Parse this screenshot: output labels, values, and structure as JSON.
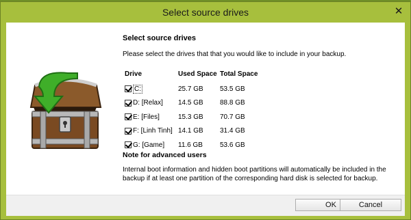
{
  "window": {
    "title": "Select source drives",
    "close_glyph": "✕"
  },
  "main": {
    "heading": "Select source drives",
    "description": "Please select the drives that that you would like to include in your backup.",
    "table": {
      "headers": {
        "drive": "Drive",
        "used": "Used Space",
        "total": "Total Space"
      },
      "rows": [
        {
          "drive": "C:",
          "used": "25.7 GB",
          "total": "53.5 GB",
          "checked": true
        },
        {
          "drive": "D: [Relax]",
          "used": "14.5 GB",
          "total": "88.8 GB",
          "checked": true
        },
        {
          "drive": "E: [Files]",
          "used": "15.3 GB",
          "total": "70.7 GB",
          "checked": true
        },
        {
          "drive": "F: [Linh Tinh]",
          "used": "14.1 GB",
          "total": "31.4 GB",
          "checked": true
        },
        {
          "drive": "G: [Game]",
          "used": "11.6 GB",
          "total": "53.6 GB",
          "checked": true
        }
      ]
    },
    "note_heading": "Note for advanced users",
    "note_text": "Internal boot information and hidden boot partitions will automatically be included in the backup if at least one partition of the corresponding hard disk is selected for backup."
  },
  "footer": {
    "ok_label": "OK",
    "cancel_label": "Cancel"
  },
  "colors": {
    "accent_green": "#a7bf3d",
    "arrow_green": "#3fae29",
    "chest_brown": "#7a4a22"
  }
}
